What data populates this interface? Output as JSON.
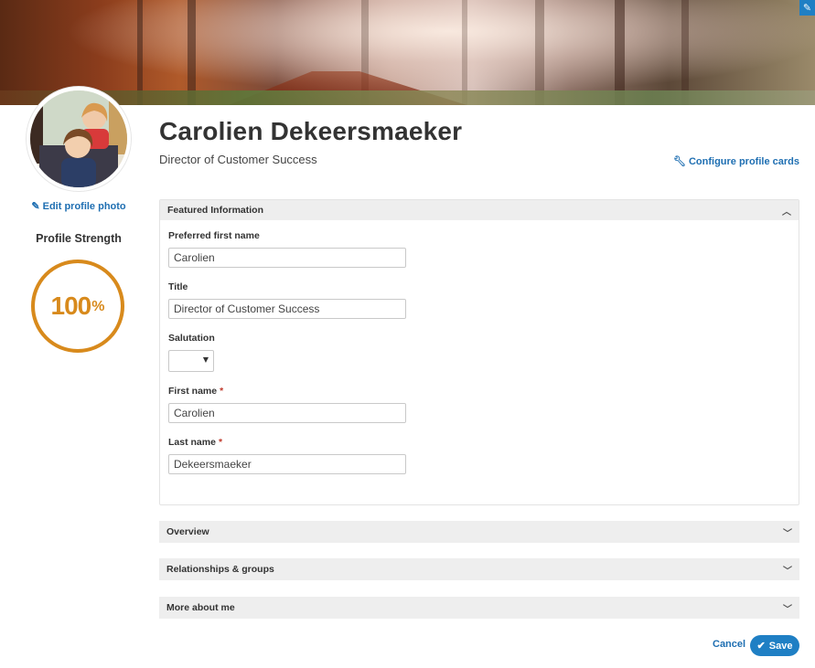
{
  "banner": {
    "edit_icon": "pencil-icon"
  },
  "profile": {
    "name": "Carolien Dekeersmaeker",
    "title": "Director of Customer Success",
    "edit_photo_label": "Edit profile photo",
    "configure_label": "Configure profile cards"
  },
  "strength": {
    "label": "Profile Strength",
    "value": "100",
    "suffix": "%",
    "fraction": 1.0,
    "color": "#d88a1c"
  },
  "featured": {
    "title": "Featured Information",
    "fields": {
      "preferred_first_name": {
        "label": "Preferred first name",
        "value": "Carolien"
      },
      "title": {
        "label": "Title",
        "value": "Director of Customer Success"
      },
      "salutation": {
        "label": "Salutation",
        "value": ""
      },
      "first_name": {
        "label": "First name",
        "required_mark": "*",
        "value": "Carolien"
      },
      "last_name": {
        "label": "Last name",
        "required_mark": "*",
        "value": "Dekeersmaeker"
      }
    }
  },
  "sections": {
    "overview": "Overview",
    "relationships": "Relationships & groups",
    "more_about_me": "More about me"
  },
  "actions": {
    "cancel": "Cancel",
    "save": "Save"
  },
  "colors": {
    "accent": "#1f7fc4",
    "link": "#1f6fb2",
    "required": "#c0392b"
  }
}
